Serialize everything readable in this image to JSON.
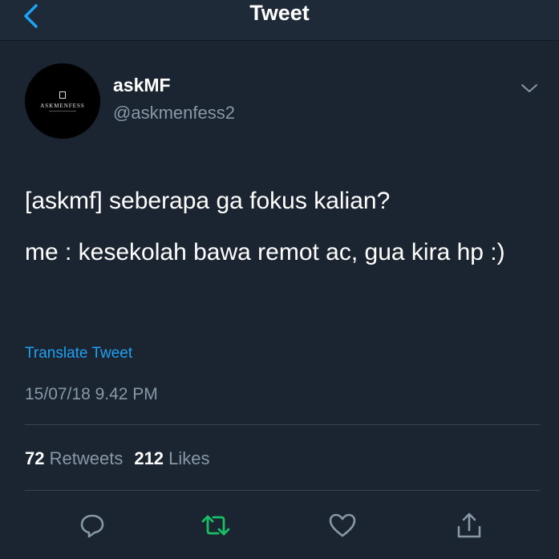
{
  "header": {
    "title": "Tweet",
    "back_icon": "chevron-left-icon"
  },
  "author": {
    "display_name": "askMF",
    "handle": "@askmenfess2",
    "avatar_text": "ASKMENFESS"
  },
  "tweet": {
    "paragraphs": [
      "[askmf] seberapa ga fokus kalian?",
      "me : kesekolah bawa remot ac, gua kira hp :)"
    ],
    "translate_label": "Translate Tweet",
    "timestamp": "15/07/18 9.42 PM"
  },
  "stats": {
    "retweets_count": "72",
    "retweets_label": "Retweets",
    "likes_count": "212",
    "likes_label": "Likes"
  },
  "actions": [
    "reply-icon",
    "retweet-icon",
    "like-icon",
    "share-icon"
  ],
  "colors": {
    "background": "#1b2431",
    "accent": "#1da1f2",
    "retweet": "#17bf63",
    "secondary_text": "#8899a6"
  }
}
